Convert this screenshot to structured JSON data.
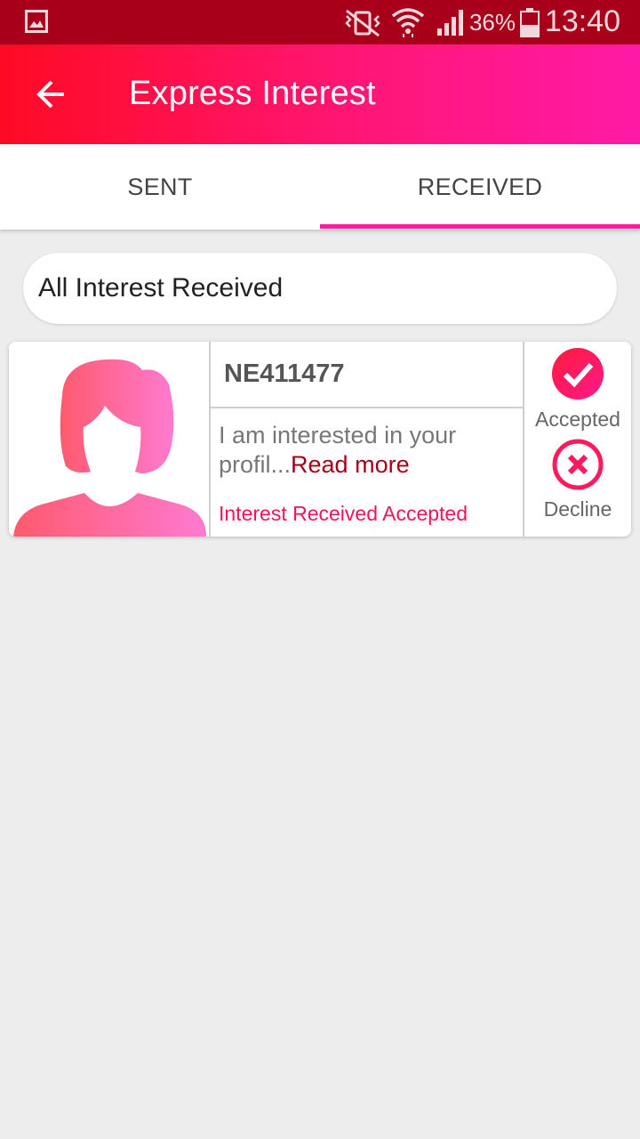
{
  "status_bar": {
    "battery_percent": "36%",
    "time": "13:40",
    "icons": [
      "gallery-icon",
      "vibrate-mute-icon",
      "wifi-icon",
      "signal-icon",
      "battery-icon"
    ]
  },
  "app_bar": {
    "title": "Express Interest",
    "back_icon": "arrow-left-icon"
  },
  "tabs": [
    {
      "label": "SENT",
      "selected": false
    },
    {
      "label": "RECEIVED",
      "selected": true
    }
  ],
  "filter": {
    "selected": "All Interest Received"
  },
  "interests": [
    {
      "profile_id": "NE411477",
      "message": "I am interested in your profil...",
      "read_more": "Read more",
      "status": "Interest Received Accepted",
      "actions": [
        {
          "label": "Accepted",
          "icon": "check-circle-icon"
        },
        {
          "label": "Decline",
          "icon": "close-circle-icon"
        }
      ]
    }
  ],
  "colors": {
    "status_bar": "#a8001a",
    "app_bar_start": "#ff0a24",
    "app_bar_end": "#ff1aa6",
    "tab_indicator": "#ff1a9e",
    "accent_text": "#f0145a",
    "read_more": "#a5001a",
    "background": "#ededed"
  }
}
